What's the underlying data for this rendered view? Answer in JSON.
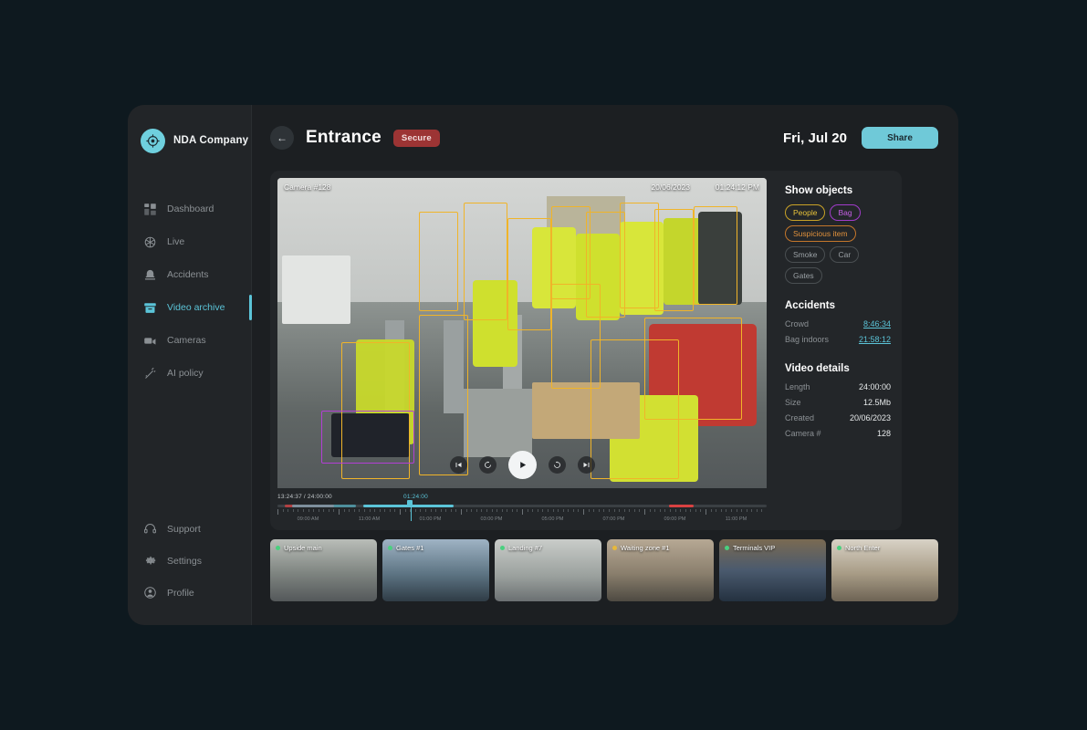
{
  "sidebar": {
    "brand": {
      "name": "NDA Company",
      "logo_icon": "target-logo-icon",
      "logo_color": "#6fd0de"
    },
    "items": [
      {
        "label": "Dashboard",
        "icon": "dashboard-grid-icon",
        "active": false
      },
      {
        "label": "Live",
        "icon": "live-aperture-icon",
        "active": false
      },
      {
        "label": "Accidents",
        "icon": "alarm-bell-icon",
        "active": false
      },
      {
        "label": "Video archive",
        "icon": "archive-box-icon",
        "active": true
      },
      {
        "label": "Cameras",
        "icon": "video-camera-icon",
        "active": false
      },
      {
        "label": "AI policy",
        "icon": "magic-wand-icon",
        "active": false
      }
    ],
    "bottom_items": [
      {
        "label": "Support",
        "icon": "headset-icon"
      },
      {
        "label": "Settings",
        "icon": "gear-icon"
      },
      {
        "label": "Profile",
        "icon": "user-avatar-icon"
      }
    ]
  },
  "header": {
    "back_icon": "arrow-left-icon",
    "title": "Entrance",
    "badge": "Secure",
    "badge_color": "#9c3434",
    "date": "Fri, Jul 20",
    "share_label": "Share",
    "share_color": "#6fc9d8"
  },
  "video": {
    "camera_label": "Camera #128",
    "date_overlay": "20/06/2023",
    "time_overlay": "01:24:12 PM",
    "controls": [
      {
        "name": "skip-back-button",
        "icon": "skip-back-icon"
      },
      {
        "name": "rewind-10-button",
        "icon": "rewind-circular-icon"
      },
      {
        "name": "play-button",
        "icon": "play-icon"
      },
      {
        "name": "forward-10-button",
        "icon": "forward-circular-icon"
      },
      {
        "name": "skip-forward-button",
        "icon": "skip-forward-icon"
      }
    ],
    "detections": [
      {
        "type": "people",
        "color": "#f0b429"
      },
      {
        "type": "bag",
        "color": "#b23fd4"
      }
    ]
  },
  "objects_panel": {
    "title": "Show objects",
    "chips": [
      {
        "label": "People",
        "active": true,
        "color": "#e8c33a"
      },
      {
        "label": "Bag",
        "active": true,
        "color": "#c560e4"
      },
      {
        "label": "Suspicious item",
        "active": true,
        "color": "#e0913c"
      },
      {
        "label": "Smoke",
        "active": false,
        "color": "#9aa0a4"
      },
      {
        "label": "Car",
        "active": false,
        "color": "#9aa0a4"
      },
      {
        "label": "Gates",
        "active": false,
        "color": "#9aa0a4"
      }
    ]
  },
  "accidents_panel": {
    "title": "Accidents",
    "rows": [
      {
        "label": "Crowd",
        "time": "8:46:34"
      },
      {
        "label": "Bag indoors",
        "time": "21:58:12"
      }
    ]
  },
  "video_details": {
    "title": "Video details",
    "rows": [
      {
        "label": "Length",
        "value": "24:00:00"
      },
      {
        "label": "Size",
        "value": "12.5Mb"
      },
      {
        "label": "Created",
        "value": "20/06/2023"
      },
      {
        "label": "Camera #",
        "value": "128"
      }
    ]
  },
  "timeline": {
    "current": "13:24:37 / 24:00:00",
    "playhead_label": "01:24:00",
    "tick_labels": [
      "09:00 AM",
      "11:00 AM",
      "01:00 PM",
      "03:00 PM",
      "05:00 PM",
      "07:00 PM",
      "09:00 PM",
      "11:00 PM"
    ],
    "progress_percent": 35,
    "accent_color": "#5bc4d8",
    "accident_marker_color": "#d94141"
  },
  "thumbnails": [
    {
      "label": "Upside main",
      "status": "online"
    },
    {
      "label": "Gates #1",
      "status": "online"
    },
    {
      "label": "Landing #7",
      "status": "online"
    },
    {
      "label": "Waiting zone #1",
      "status": "warning"
    },
    {
      "label": "Terminals VIP",
      "status": "online"
    },
    {
      "label": "North Enter",
      "status": "online"
    }
  ]
}
